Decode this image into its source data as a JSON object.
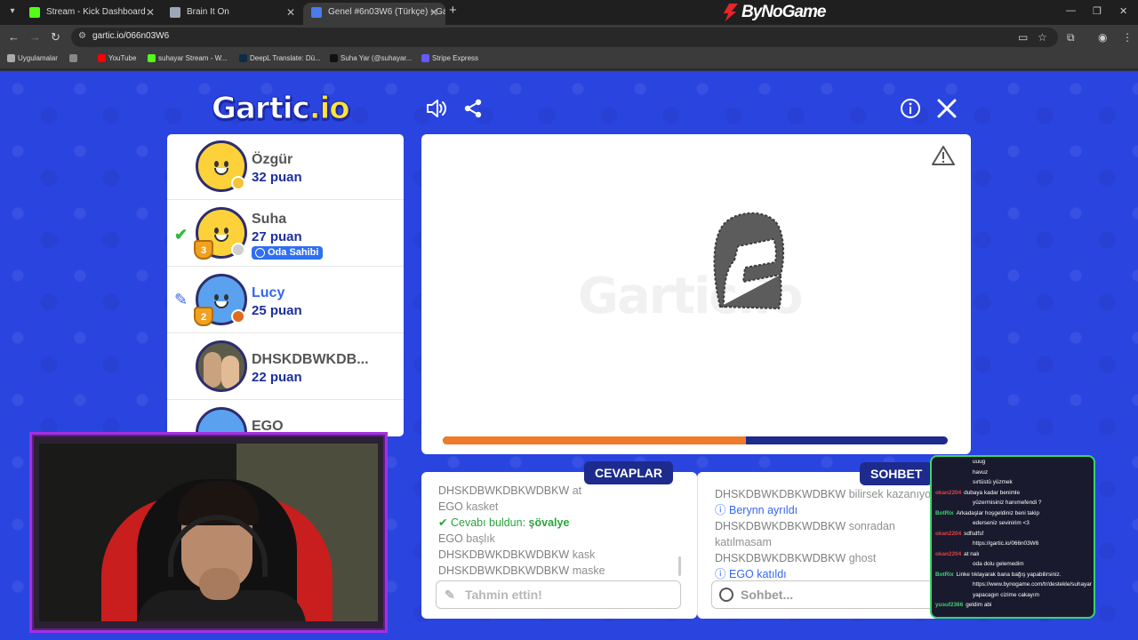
{
  "browser": {
    "tabs": [
      {
        "title": "Stream - Kick Dashboard",
        "fav_color": "#53fc18"
      },
      {
        "title": "Brain It On",
        "fav_color": "#9aa7b5"
      },
      {
        "title": "Genel #6n03W6 (Türkçe) - Garti",
        "fav_color": "#4b7bec"
      }
    ],
    "brand": "ByNoGame",
    "url": "gartic.io/066n03W6",
    "bookmarks": [
      {
        "label": "Uygulamalar",
        "color": "#aaaaaa"
      },
      {
        "label": "YouTube",
        "color": "#ff0000"
      },
      {
        "label": "suhayar Stream - W...",
        "color": "#53fc18"
      },
      {
        "label": "DeepL Translate: Dü...",
        "color": "#0f2b46"
      },
      {
        "label": "Suha Yar (@suhayar...",
        "color": "#111111"
      },
      {
        "label": "Stripe Express",
        "color": "#635bff"
      }
    ]
  },
  "game": {
    "logo": "Gartic",
    "logo_suffix": ".io",
    "players": [
      {
        "name": "Özgür",
        "score": "32 puan",
        "status_color": "#f6c23a"
      },
      {
        "name": "Suha",
        "score": "27 puan",
        "badge": "Oda Sahibi",
        "trophy": "3",
        "status_color": "#cfcfcf"
      },
      {
        "name": "Lucy",
        "score": "25 puan",
        "trophy": "2",
        "status_color": "#e06b1f"
      },
      {
        "name": "DHSKDBWKDB...",
        "score": "22 puan"
      },
      {
        "name": "EGO",
        "score": ""
      }
    ],
    "canvas_watermark": "Gartic.io",
    "timer_progress": 0.6,
    "answers_title": "CEVAPLAR",
    "chat_title": "SOHBET",
    "answers": [
      {
        "user": "DHSKDBWKDBKWDBKW",
        "text": "at"
      },
      {
        "user": "EGO",
        "text": "kasket"
      },
      {
        "user": "",
        "text": "Cevabı buldun:",
        "word": "şövalye",
        "correct": true
      },
      {
        "user": "EGO",
        "text": "başlık"
      },
      {
        "user": "DHSKDBWKDBKWDBKW",
        "text": "kask"
      },
      {
        "user": "DHSKDBWKDBKWDBKW",
        "text": "maske"
      }
    ],
    "guess_placeholder": "Tahmin ettin!",
    "chat": [
      {
        "user": "DHSKDBWKDBKWDBKW",
        "text": "bilirsek kazanıyor"
      },
      {
        "info": true,
        "user": "Berynn",
        "text": "ayrıldı"
      },
      {
        "user": "DHSKDBWKDBKWDBKW",
        "text": "sonradan"
      },
      {
        "user": "",
        "text": "katılmasam"
      },
      {
        "user": "DHSKDBWKDBKWDBKW",
        "text": "ghost"
      },
      {
        "info": true,
        "user": "EGO",
        "text": "katıldı"
      }
    ],
    "chat_placeholder": "Sohbet..."
  },
  "stream_chat": [
    {
      "user": "",
      "text": "uuug",
      "color": "#e64040"
    },
    {
      "user": "",
      "text": "havuz",
      "color": "#e64040"
    },
    {
      "user": "",
      "text": "sırtüstü yüzmek",
      "color": "#e64040"
    },
    {
      "user": "okan2204",
      "text": "dubaya kadar benimle",
      "color": "#e64040"
    },
    {
      "user": "",
      "text": "yüzermisiniz hanımefendi ?",
      "color": "#e64040"
    },
    {
      "user": "BotRix",
      "text": "Arkadaşlar hoşgeldiniz beni takip",
      "color": "#39d66c"
    },
    {
      "user": "",
      "text": "ederseniz sevinirim <3",
      "color": "#39d66c"
    },
    {
      "user": "okan2204",
      "text": "sdfsdfsf",
      "color": "#e64040"
    },
    {
      "user": "",
      "text": "https://gartic.io/066n03W6",
      "color": "#e64040"
    },
    {
      "user": "okan2204",
      "text": "at nalı",
      "color": "#e64040"
    },
    {
      "user": "",
      "text": "oda dolu gelemedim",
      "color": "#e64040"
    },
    {
      "user": "BotRix",
      "text": "Linke tıklayarak bana bağış yapabilirsiniz.",
      "color": "#39d66c"
    },
    {
      "user": "",
      "text": "https://www.bynogame.com/tr/destekle/suhayar",
      "color": "#39d66c"
    },
    {
      "user": "",
      "text": "yapacagın cizime cakayım",
      "color": "#e64040"
    },
    {
      "user": "yusuf2366",
      "text": "geldim abi",
      "color": "#39d66c"
    }
  ]
}
